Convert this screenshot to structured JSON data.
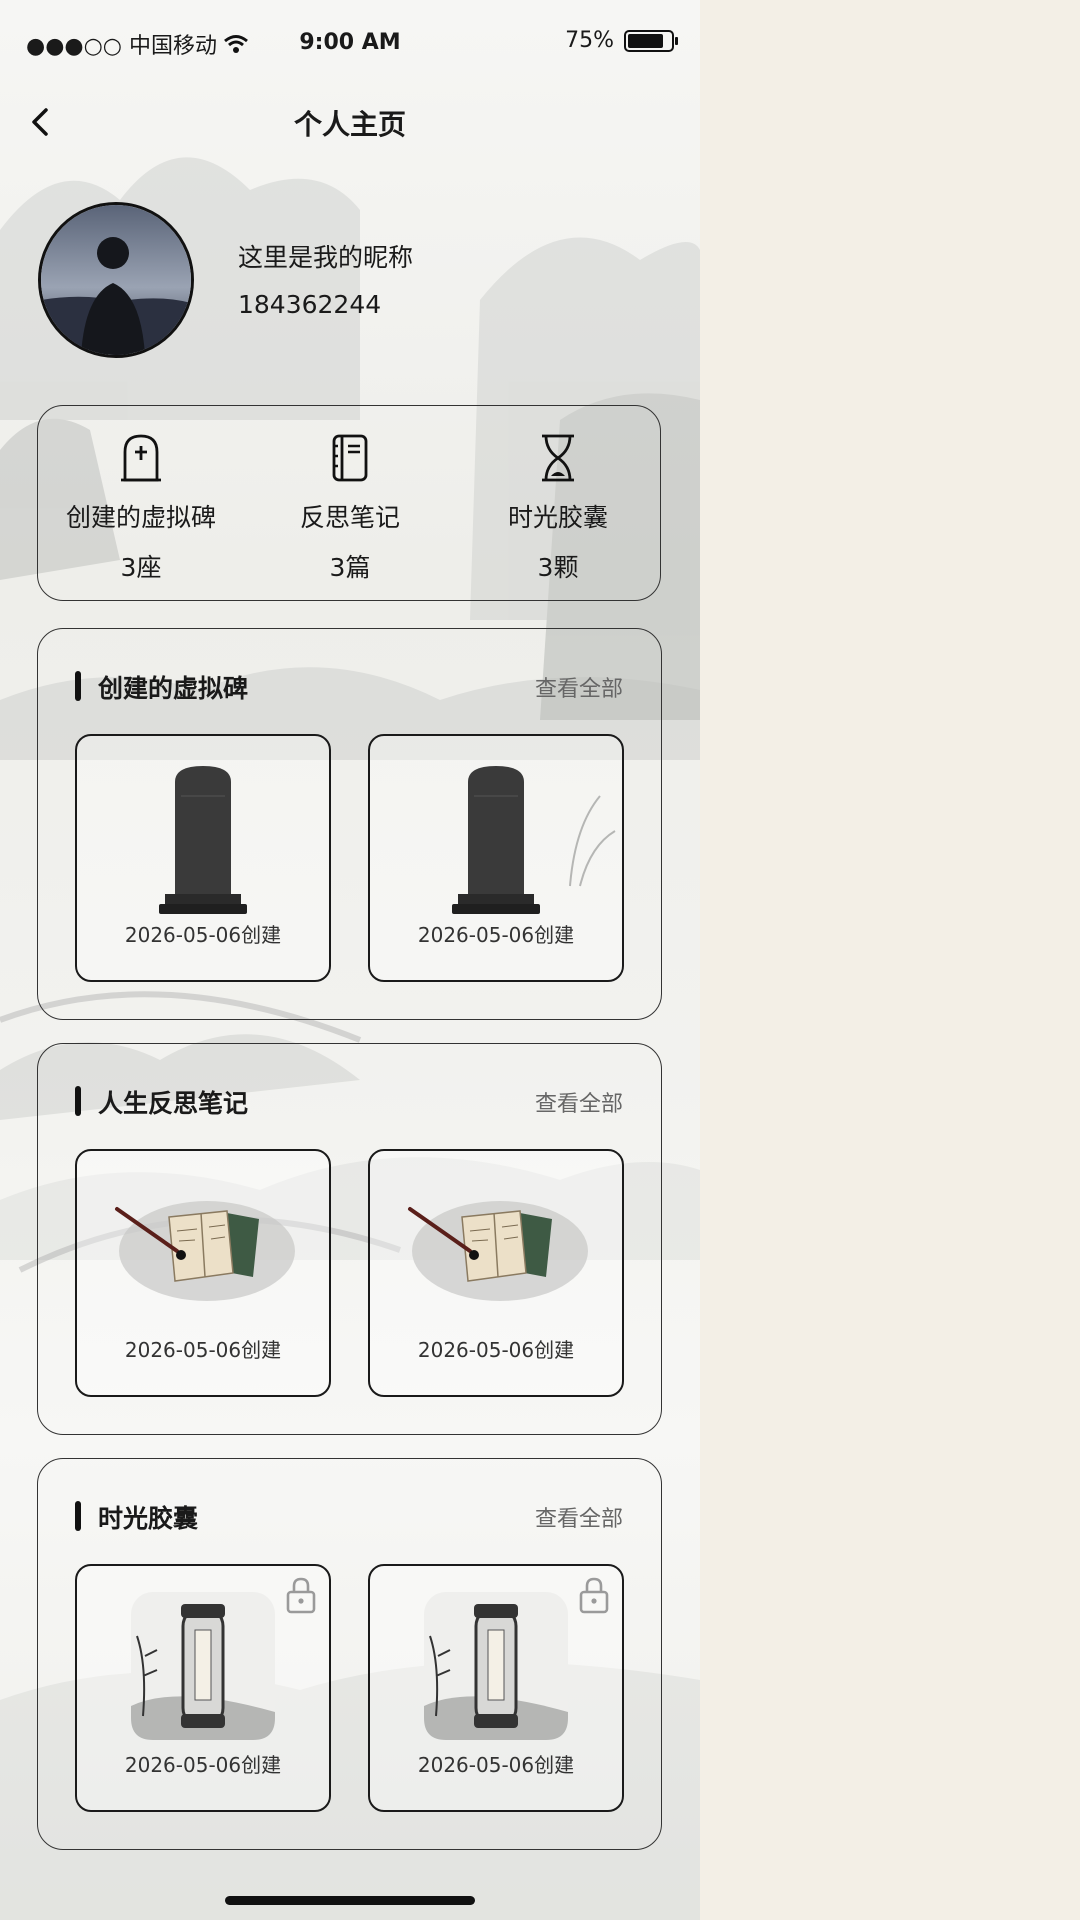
{
  "status_bar": {
    "carrier": "●●●○○ 中国移动",
    "time": "9:00 AM",
    "battery": "75%"
  },
  "nav": {
    "title": "个人主页"
  },
  "profile": {
    "nickname": "这里是我的昵称",
    "id": "184362244"
  },
  "stats": [
    {
      "icon": "tombstone-icon",
      "label": "创建的虚拟碑",
      "count": "3座"
    },
    {
      "icon": "notebook-icon",
      "label": "反思笔记",
      "count": "3篇"
    },
    {
      "icon": "hourglass-icon",
      "label": "时光胶囊",
      "count": "3颗"
    }
  ],
  "sections": [
    {
      "title": "创建的虚拟碑",
      "more": "查看全部",
      "items": [
        {
          "date": "2026-05-06创建"
        },
        {
          "date": "2026-05-06创建"
        }
      ]
    },
    {
      "title": "人生反思笔记",
      "more": "查看全部",
      "items": [
        {
          "date": "2026-05-06创建"
        },
        {
          "date": "2026-05-06创建"
        }
      ]
    },
    {
      "title": "时光胶囊",
      "more": "查看全部",
      "items": [
        {
          "date": "2026-05-06创建",
          "locked": true
        },
        {
          "date": "2026-05-06创建",
          "locked": true
        }
      ]
    }
  ]
}
